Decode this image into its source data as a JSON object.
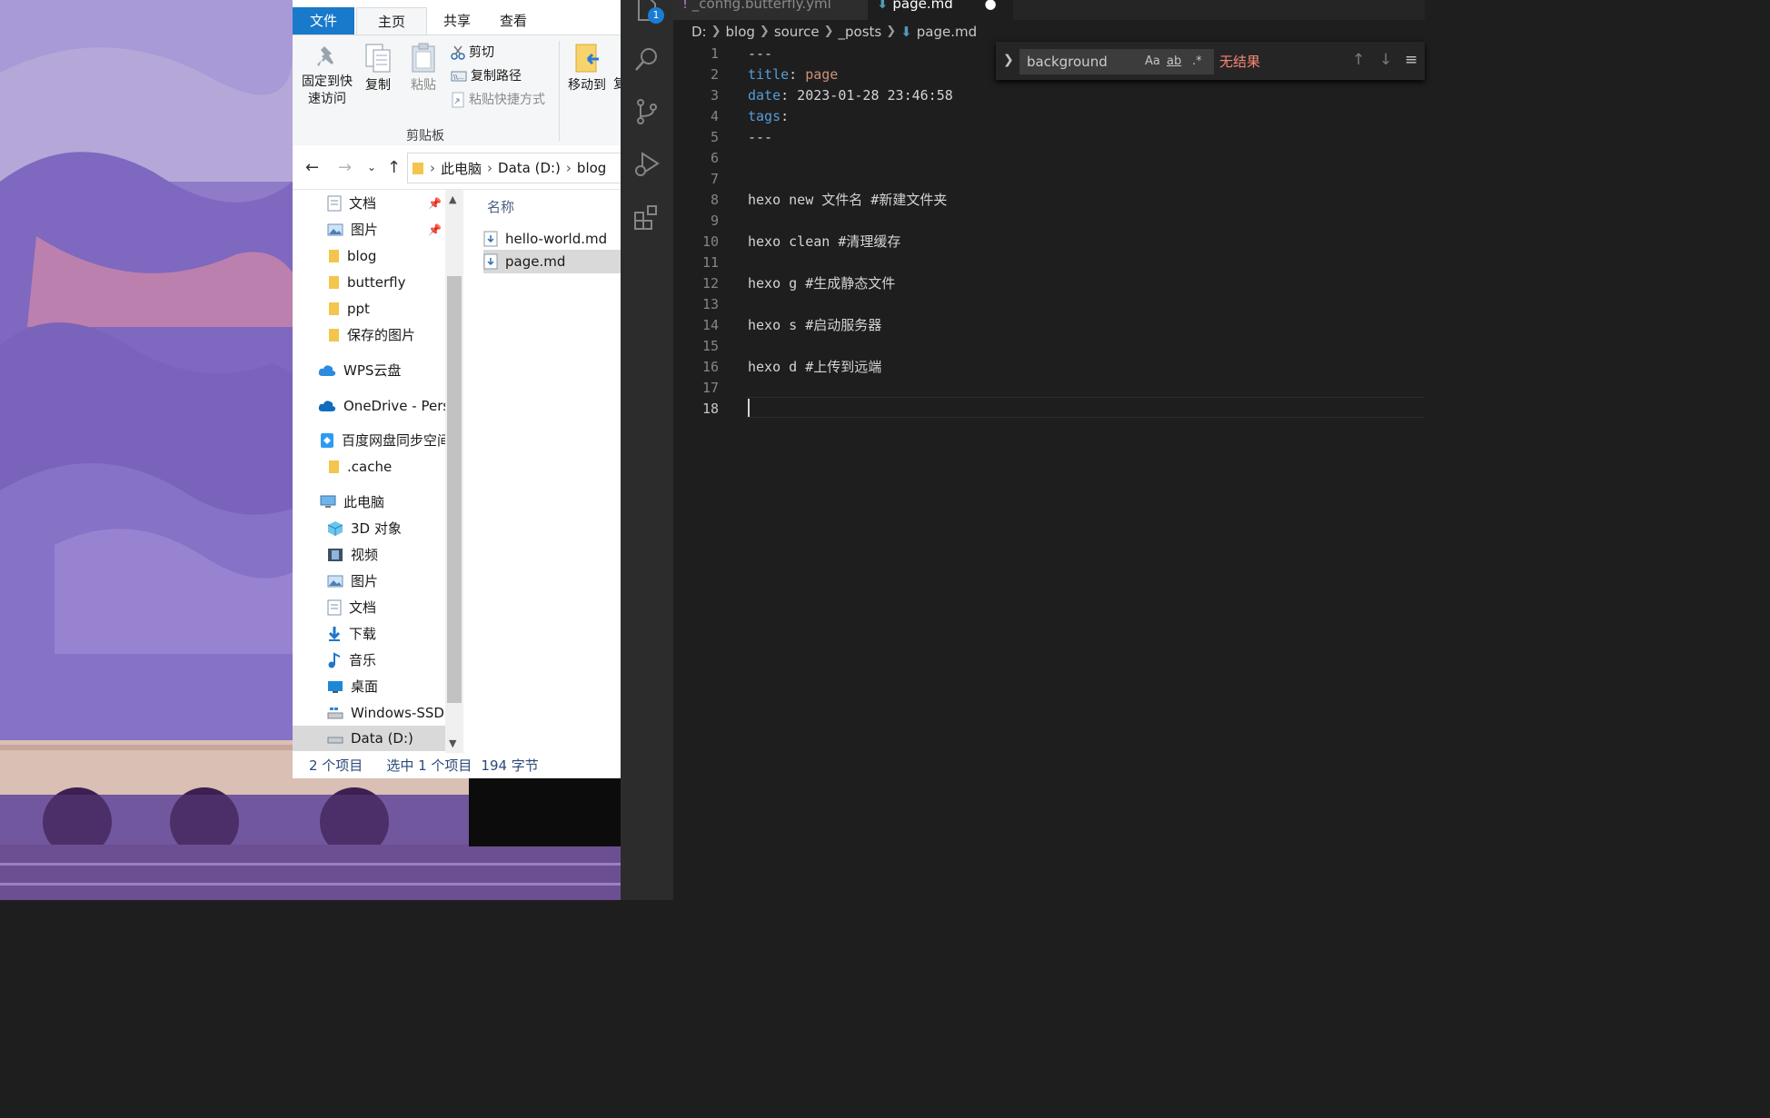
{
  "explorer": {
    "ribbon_tabs": [
      "文件",
      "主页",
      "共享",
      "查看"
    ],
    "ribbon": {
      "pin_label_1": "固定到快",
      "pin_label_2": "速访问",
      "copy": "复制",
      "paste": "粘贴",
      "cut": "剪切",
      "copy_path": "复制路径",
      "paste_shortcut": "粘贴快捷方式",
      "move_to": "移动到",
      "copy_to_partial": "复",
      "group_label": "剪贴板"
    },
    "address": {
      "crumbs": [
        "此电脑",
        "Data (D:)",
        "blog"
      ]
    },
    "nav": [
      {
        "label": "文档",
        "pinned": true
      },
      {
        "label": "图片",
        "pinned": true
      },
      {
        "label": "blog"
      },
      {
        "label": "butterfly"
      },
      {
        "label": "ppt"
      },
      {
        "label": "保存的图片"
      },
      {
        "label": "WPS云盘"
      },
      {
        "label": "OneDrive - Persc"
      },
      {
        "label": "百度网盘同步空间"
      },
      {
        "label": ".cache"
      },
      {
        "label": "此电脑"
      },
      {
        "label": "3D 对象"
      },
      {
        "label": "视频"
      },
      {
        "label": "图片"
      },
      {
        "label": "文档"
      },
      {
        "label": "下载"
      },
      {
        "label": "音乐"
      },
      {
        "label": "桌面"
      },
      {
        "label": "Windows-SSD ("
      },
      {
        "label": "Data (D:)"
      }
    ],
    "column_header": "名称",
    "files": [
      "hello-world.md",
      "page.md"
    ],
    "status": {
      "count": "2 个项目",
      "selected": "选中 1 个项目",
      "size": "194 字节"
    }
  },
  "vscode": {
    "badge": "1",
    "tabs": [
      "_config.butterfly.yml",
      "page.md"
    ],
    "breadcrumbs": [
      "D:",
      "blog",
      "source",
      "_posts",
      "page.md"
    ],
    "find": {
      "query": "background",
      "opt_case": "Aa",
      "opt_word": "ab",
      "opt_regex": ".*",
      "result": "无结果"
    },
    "lines": [
      {
        "n": "1",
        "parts": [
          {
            "t": "---",
            "c": "w"
          }
        ]
      },
      {
        "n": "2",
        "parts": [
          {
            "t": "title",
            "c": "k"
          },
          {
            "t": ": ",
            "c": "w"
          },
          {
            "t": "page",
            "c": "s"
          }
        ]
      },
      {
        "n": "3",
        "parts": [
          {
            "t": "date",
            "c": "k"
          },
          {
            "t": ": 2023-01-28 23:46:58",
            "c": "w"
          }
        ]
      },
      {
        "n": "4",
        "parts": [
          {
            "t": "tags",
            "c": "k"
          },
          {
            "t": ":",
            "c": "w"
          }
        ]
      },
      {
        "n": "5",
        "parts": [
          {
            "t": "---",
            "c": "w"
          }
        ]
      },
      {
        "n": "6",
        "parts": []
      },
      {
        "n": "7",
        "parts": []
      },
      {
        "n": "8",
        "parts": [
          {
            "t": "hexo new 文件名 #新建文件夹",
            "c": "w"
          }
        ]
      },
      {
        "n": "9",
        "parts": []
      },
      {
        "n": "10",
        "parts": [
          {
            "t": "hexo clean #清理缓存",
            "c": "w"
          }
        ]
      },
      {
        "n": "11",
        "parts": []
      },
      {
        "n": "12",
        "parts": [
          {
            "t": "hexo g #生成静态文件",
            "c": "w"
          }
        ]
      },
      {
        "n": "13",
        "parts": []
      },
      {
        "n": "14",
        "parts": [
          {
            "t": "hexo s #启动服务器",
            "c": "w"
          }
        ]
      },
      {
        "n": "15",
        "parts": []
      },
      {
        "n": "16",
        "parts": [
          {
            "t": "hexo d #上传到远端",
            "c": "w"
          }
        ]
      },
      {
        "n": "17",
        "parts": []
      },
      {
        "n": "18",
        "parts": [],
        "current": true
      }
    ]
  }
}
